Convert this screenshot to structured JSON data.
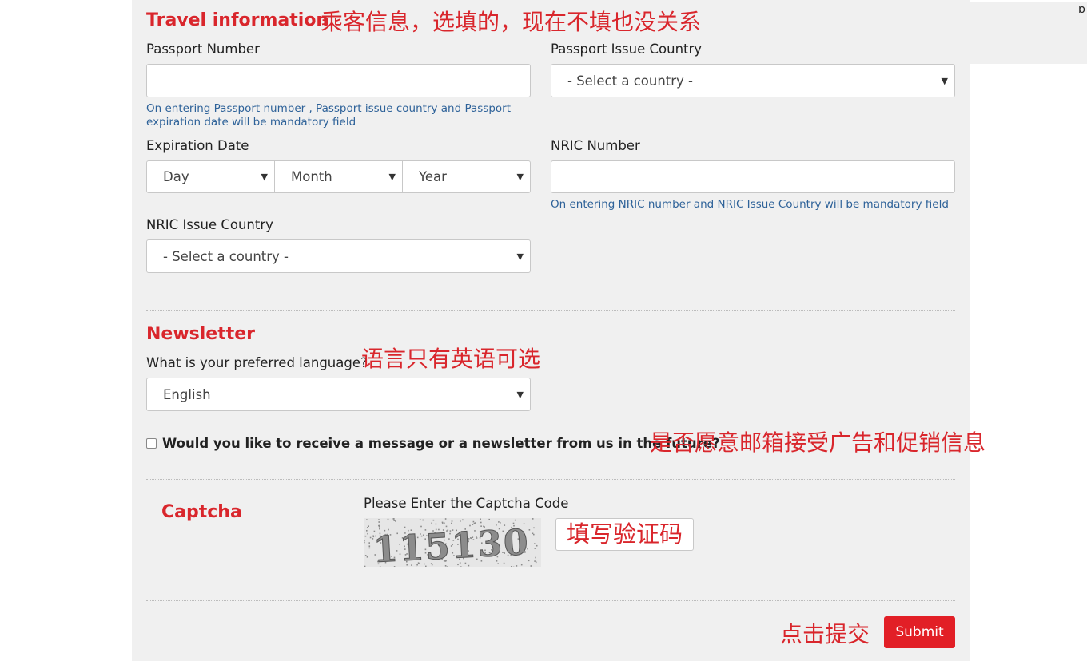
{
  "travel": {
    "title": "Travel information",
    "note": "乘客信息，选填的，现在不填也没关系",
    "passport_number_label": "Passport Number",
    "passport_number_value": "",
    "passport_hint": "On entering Passport number , Passport issue country and Passport expiration date will be mandatory field",
    "passport_country_label": "Passport Issue Country",
    "passport_country_value": "- Select a country -",
    "expiration_label": "Expiration Date",
    "day_value": "Day",
    "month_value": "Month",
    "year_value": "Year",
    "nric_number_label": "NRIC Number",
    "nric_number_value": "",
    "nric_hint": "On entering NRIC number and NRIC Issue Country will be mandatory field",
    "nric_country_label": "NRIC Issue Country",
    "nric_country_value": "- Select a country -"
  },
  "newsletter": {
    "title": "Newsletter",
    "language_label": "What is your preferred language?",
    "language_note": "语言只有英语可选",
    "language_value": "English",
    "opt_in_label": "Would you like to receive a message or a newsletter from us in the future?",
    "opt_in_note": "是否愿意邮箱接受广告和促销信息",
    "opt_in_checked": false
  },
  "captcha": {
    "title": "Captcha",
    "prompt": "Please Enter the Captcha Code",
    "image_code": "115130",
    "input_note": "填写验证码"
  },
  "footer": {
    "submit_note": "点击提交",
    "submit_label": "Submit"
  },
  "icons": {
    "dropdown": "chevron-down-icon"
  },
  "colors": {
    "accent_red": "#d9262c",
    "button_red": "#e21f26",
    "hint_blue": "#2e6299",
    "panel_bg": "#f0f0f0"
  }
}
